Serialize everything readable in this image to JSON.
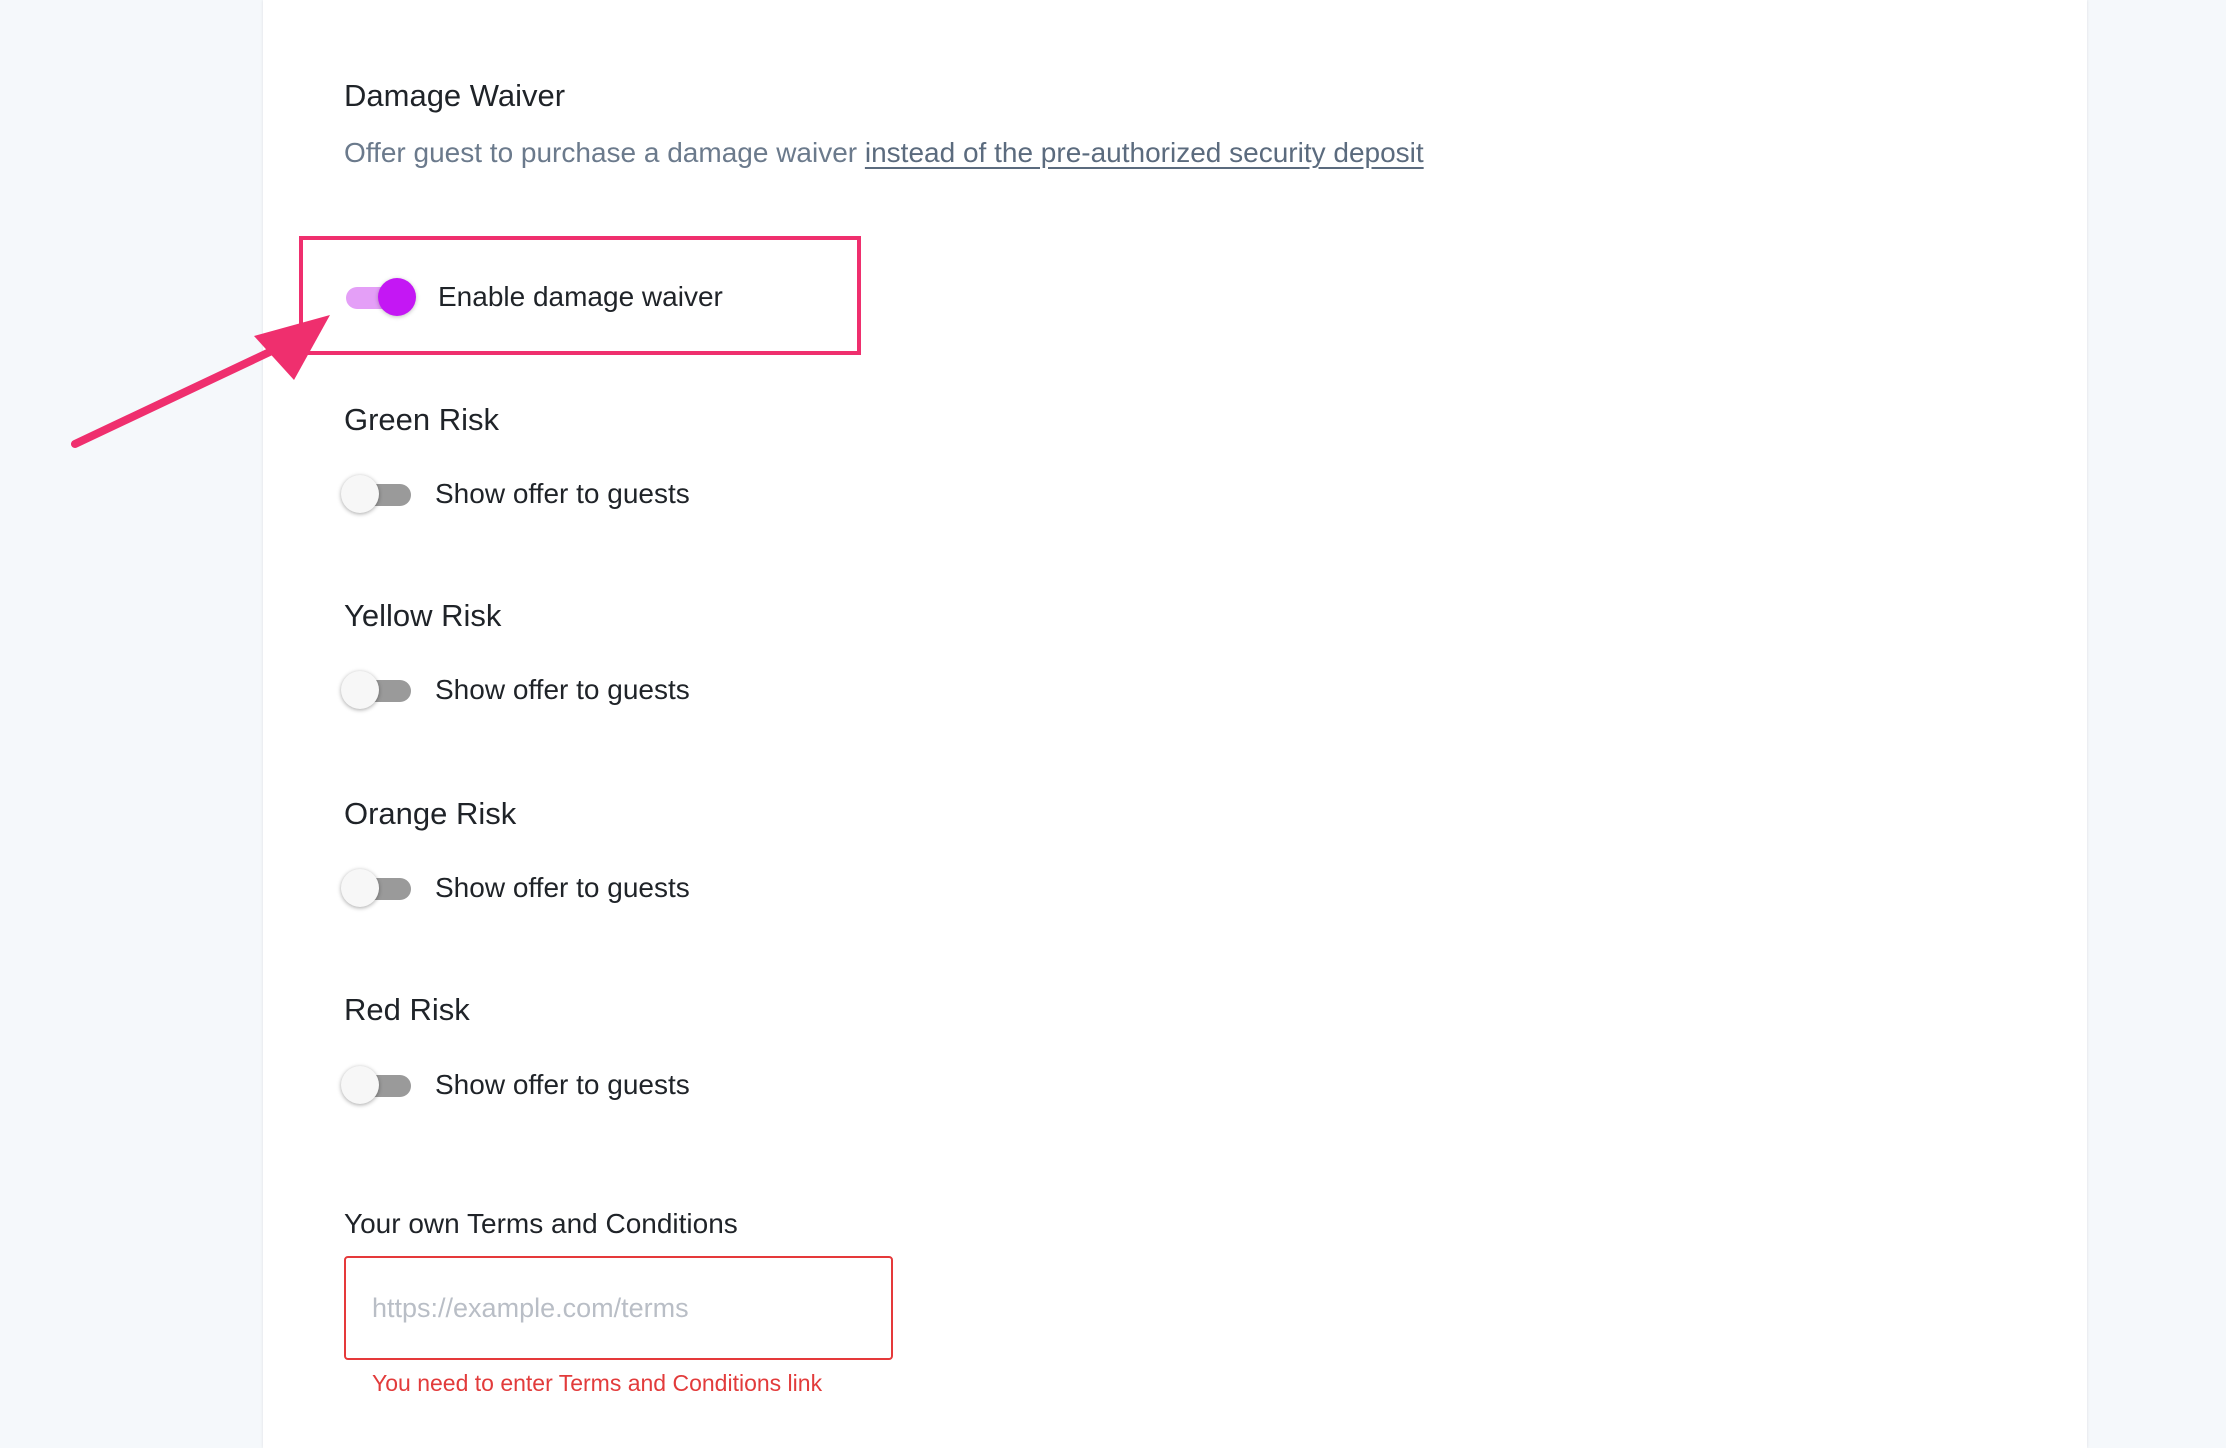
{
  "damage_waiver": {
    "title": "Damage Waiver",
    "subtitle_text": "Offer guest to purchase a damage waiver ",
    "subtitle_link": "instead of the pre-authorized security deposit",
    "enable_toggle": {
      "label": "Enable damage waiver",
      "checked": true
    }
  },
  "risk_levels": [
    {
      "title": "Green Risk",
      "toggle_label": "Show offer to guests",
      "checked": false
    },
    {
      "title": "Yellow Risk",
      "toggle_label": "Show offer to guests",
      "checked": false
    },
    {
      "title": "Orange Risk",
      "toggle_label": "Show offer to guests",
      "checked": false
    },
    {
      "title": "Red Risk",
      "toggle_label": "Show offer to guests",
      "checked": false
    }
  ],
  "terms": {
    "label": "Your own Terms and Conditions",
    "value": "",
    "placeholder": "https://example.com/terms",
    "error": "You need to enter Terms and Conditions link"
  },
  "colors": {
    "page_background": "#f5f8fb",
    "card_background": "#ffffff",
    "toggle_on_thumb": "#c417f4",
    "toggle_on_track": "#e49ff7",
    "toggle_off_track": "#9a9a9a",
    "annotation": "#ef2f6e",
    "error": "#e23b3b",
    "muted_text": "#6b7a8c"
  }
}
